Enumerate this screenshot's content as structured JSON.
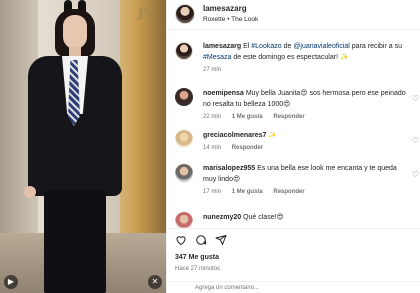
{
  "post": {
    "username": "lamesazarg",
    "audio": "Roxette • The Look",
    "caption_pre": "El ",
    "caption_tag1": "#Lookazo",
    "caption_mid1": " de ",
    "caption_mention": "@juanavialeoficial",
    "caption_mid2": " para recibir a su ",
    "caption_tag2": "#Mesaza",
    "caption_post": " de este domingo es espectacular! ",
    "caption_emoji": "✨",
    "caption_time": "27 min"
  },
  "comments": [
    {
      "user": "noemipensa",
      "text": "Muy bella Juanita",
      "emoji1": "😍",
      "text2": " sos hermosa pero ese peinado no resalta tu belleza 1000",
      "emoji2": "😍",
      "time": "22 min",
      "likes": "1 Me gusta",
      "reply": "Responder"
    },
    {
      "user": "greciacolmenares7",
      "text": "",
      "emoji1": "✨",
      "time": "14 min",
      "reply": "Responder"
    },
    {
      "user": "marisalopez955",
      "text": "Es una bella ese look me encanta y te queda muy lindo",
      "emoji1": "😍",
      "time": "17 min",
      "likes": "1 Me gusta",
      "reply": "Responder"
    },
    {
      "user": "nunezmy20",
      "text": "Qué clase!",
      "emoji1": "😍"
    }
  ],
  "stats": {
    "likes": "347 Me gusta",
    "time_ago": "Hace 27 minutos"
  },
  "add_comment": {
    "placeholder": "Agrega un comentario..."
  },
  "media_logo": "JV",
  "colors": {
    "link": "#00376b",
    "muted": "#737373",
    "text": "#262626"
  }
}
